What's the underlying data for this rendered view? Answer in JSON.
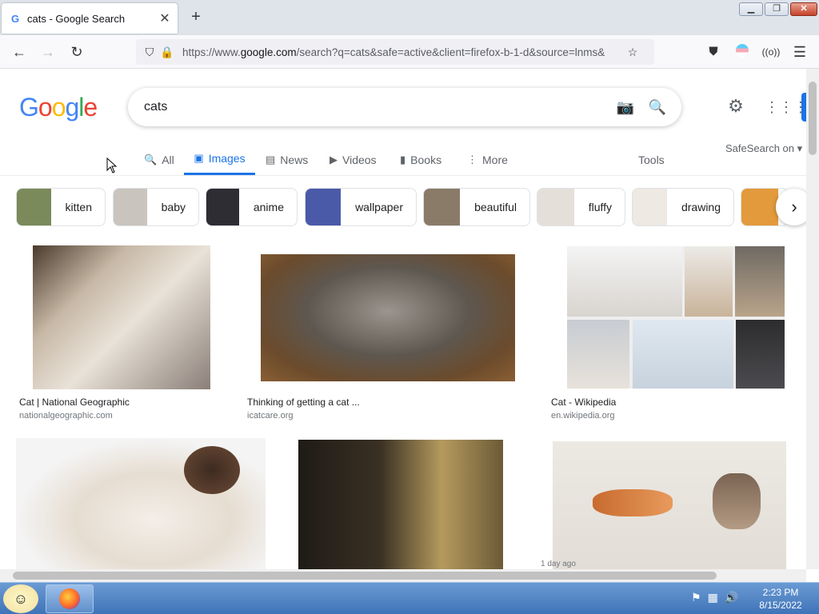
{
  "browser": {
    "tab_title": "cats - Google Search",
    "tab_favicon": "G",
    "new_tab_icon": "+",
    "url_prefix": "https://www.",
    "url_domain": "google.com",
    "url_rest": "/search?q=cats&safe=active&client=firefox-b-1-d&source=lnms&"
  },
  "google": {
    "logo_letters": [
      "G",
      "o",
      "o",
      "g",
      "l",
      "e"
    ],
    "logo_colors": [
      "#4285f4",
      "#ea4335",
      "#fbbc05",
      "#4285f4",
      "#34a853",
      "#ea4335"
    ],
    "query": "cats",
    "tabs": [
      {
        "label": "All",
        "icon": "search-icon",
        "glyph": "🔍"
      },
      {
        "label": "Images",
        "icon": "image-icon",
        "glyph": "▣"
      },
      {
        "label": "News",
        "icon": "news-icon",
        "glyph": "▤"
      },
      {
        "label": "Videos",
        "icon": "video-icon",
        "glyph": "▶"
      },
      {
        "label": "Books",
        "icon": "book-icon",
        "glyph": "▮"
      },
      {
        "label": "More",
        "icon": "more-icon",
        "glyph": "⋮"
      }
    ],
    "active_tab": "Images",
    "tools_label": "Tools",
    "safesearch_label": "SafeSearch on"
  },
  "chips": [
    "kitten",
    "baby",
    "anime",
    "wallpaper",
    "beautiful",
    "fluffy",
    "drawing"
  ],
  "results": [
    {
      "title": "Cat | National Geographic",
      "source": "nationalgeographic.com"
    },
    {
      "title": "Thinking of getting a cat ...",
      "source": "icatcare.org"
    },
    {
      "title": "Cat - Wikipedia",
      "source": "en.wikipedia.org"
    },
    {
      "title": "",
      "source": ""
    },
    {
      "title": "",
      "source": ""
    },
    {
      "title": "",
      "source": "1 day ago"
    }
  ],
  "taskbar": {
    "time": "2:23 PM",
    "date": "8/15/2022"
  },
  "colors": {
    "accent": "#1a73e8",
    "search_icon": "#4285f4"
  }
}
